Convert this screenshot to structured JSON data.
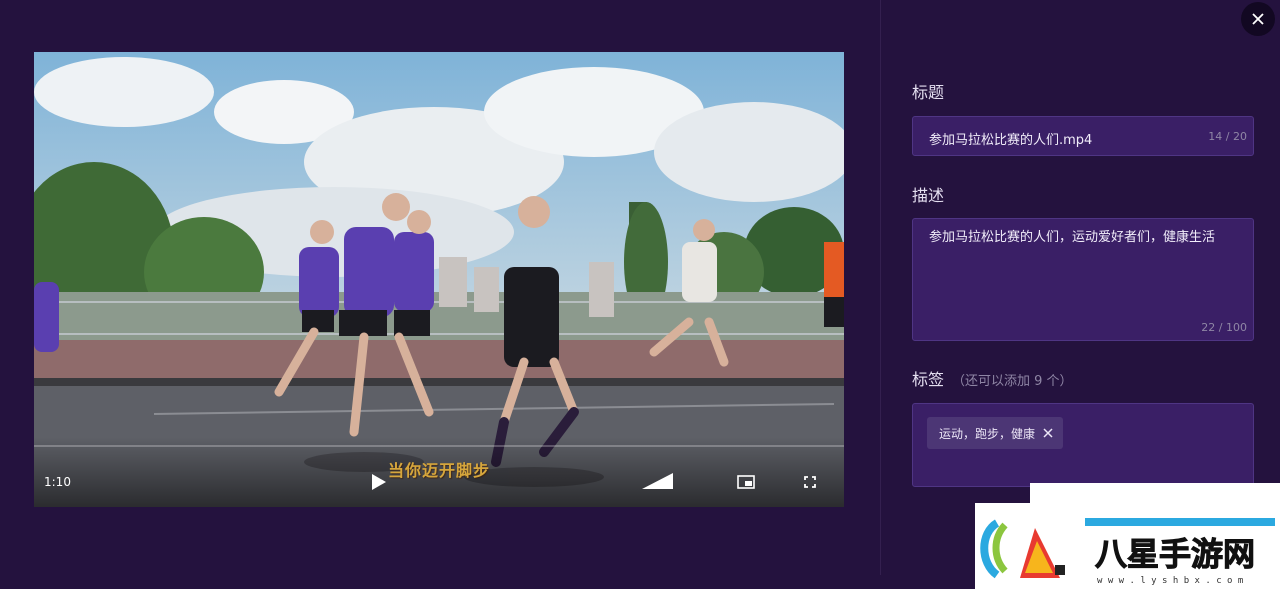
{
  "video": {
    "current_time": "1:10",
    "progress_fraction": 0.0,
    "subtitle": "当你迈开脚步",
    "icons": {
      "play": "play-icon",
      "volume": "volume-icon",
      "pip": "picture-in-picture-icon",
      "fullscreen": "fullscreen-icon"
    }
  },
  "panel": {
    "close_icon": "close-icon",
    "title_label": "标题",
    "title_value": "参加马拉松比赛的人们.mp4",
    "title_counter": "14 / 20",
    "description_label": "描述",
    "description_value": "参加马拉松比赛的人们，运动爱好者们，健康生活",
    "description_counter": "22 / 100",
    "tags_label": "标签",
    "tags_hint": "（还可以添加 9 个）",
    "tags": [
      "运动，跑步，健康"
    ]
  },
  "watermark": {
    "text": "八星手游网",
    "url": "w w w . l y s h b x . c o m"
  },
  "colors": {
    "background": "#24123e",
    "field_bg": "#3a1f66",
    "tag_bg": "#4c3675",
    "accent": "#7fa0ff"
  }
}
